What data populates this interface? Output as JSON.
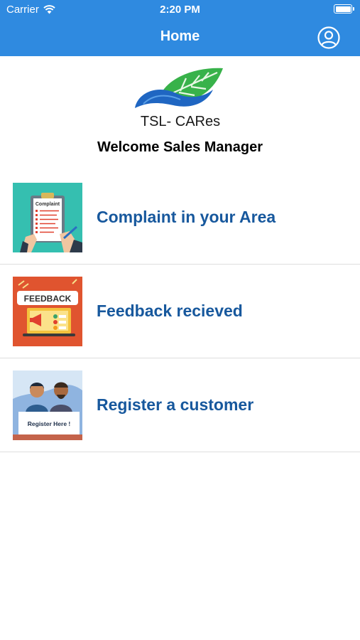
{
  "status_bar": {
    "carrier": "Carrier",
    "time": "2:20 PM"
  },
  "nav": {
    "title": "Home",
    "profile_icon": "user-circle-icon"
  },
  "logo": {
    "text": "TSL- CARes",
    "icon": "leaf-hand-icon"
  },
  "welcome": "Welcome Sales Manager",
  "menu": [
    {
      "label": "Complaint in your Area",
      "image_text": "Complaint"
    },
    {
      "label": "Feedback recieved",
      "image_text": "FEEDBACK"
    },
    {
      "label": "Register a customer",
      "image_text": "Register Here !"
    }
  ],
  "colors": {
    "nav_bar": "#2f8ae0",
    "menu_text": "#17589d",
    "separator": "#dedede"
  }
}
